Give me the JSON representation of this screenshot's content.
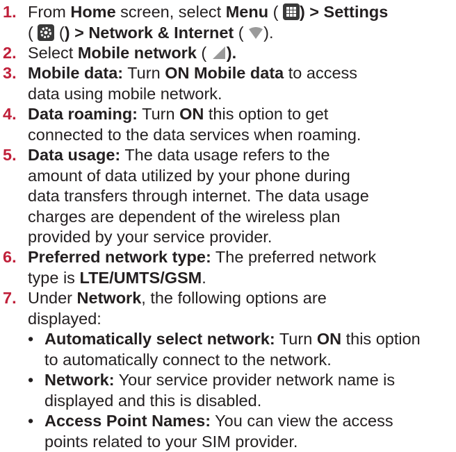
{
  "steps": [
    {
      "num": "1.",
      "t1": "From ",
      "b1": "Home",
      "t2": " screen, select ",
      "b2": "Menu",
      "t3": " (",
      "b3": ") > Settings",
      "t4": "(",
      "b4": ") > Network & Internet",
      "t5": " (",
      "t6": ")."
    },
    {
      "num": "2.",
      "t1": "Select ",
      "b1": "Mobile network",
      "t2": " (",
      "b2": ")."
    },
    {
      "num": "3.",
      "b1": "Mobile data:",
      "t1": " Turn ",
      "b2": "ON Mobile data",
      "t2": " to access",
      "l2": "data using mobile network."
    },
    {
      "num": "4.",
      "b1": "Data roaming:",
      "t1": " Turn ",
      "b2": "ON",
      "t2": " this option to get",
      "l2": "connected to the data services when roaming."
    },
    {
      "num": "5.",
      "b1": "Data usage:",
      "t1": " The data usage refers to the",
      "l2": "amount of data utilized by your phone during",
      "l3": "data transfers through internet. The data usage",
      "l4": "charges are dependent of the wireless plan",
      "l5": "provided by your service provider."
    },
    {
      "num": "6.",
      "b1": "Preferred network type:",
      "t1": " The preferred network",
      "t2": "type is ",
      "b2": "LTE/UMTS/GSM",
      "t3": "."
    },
    {
      "num": "7.",
      "t1": "Under ",
      "b1": "Network",
      "t2": ", the following options are",
      "l2": "displayed:"
    }
  ],
  "bullets": [
    {
      "dot": "•",
      "b1": "Automatically select network:",
      "t1": " Turn ",
      "b2": "ON",
      "t2": " this option",
      "l2": "to automatically connect to the network."
    },
    {
      "dot": "•",
      "b1": "Network:",
      "t1": " Your service provider network name is",
      "l2": "displayed and this is disabled."
    },
    {
      "dot": "•",
      "b1": "Access Point Names:",
      "t1": " You can view the access",
      "l2": "points related to your SIM provider."
    }
  ],
  "icons": {
    "menu": "apps-grid-icon",
    "settings": "gear-icon",
    "network": "wifi-icon",
    "mobile": "signal-icon"
  }
}
